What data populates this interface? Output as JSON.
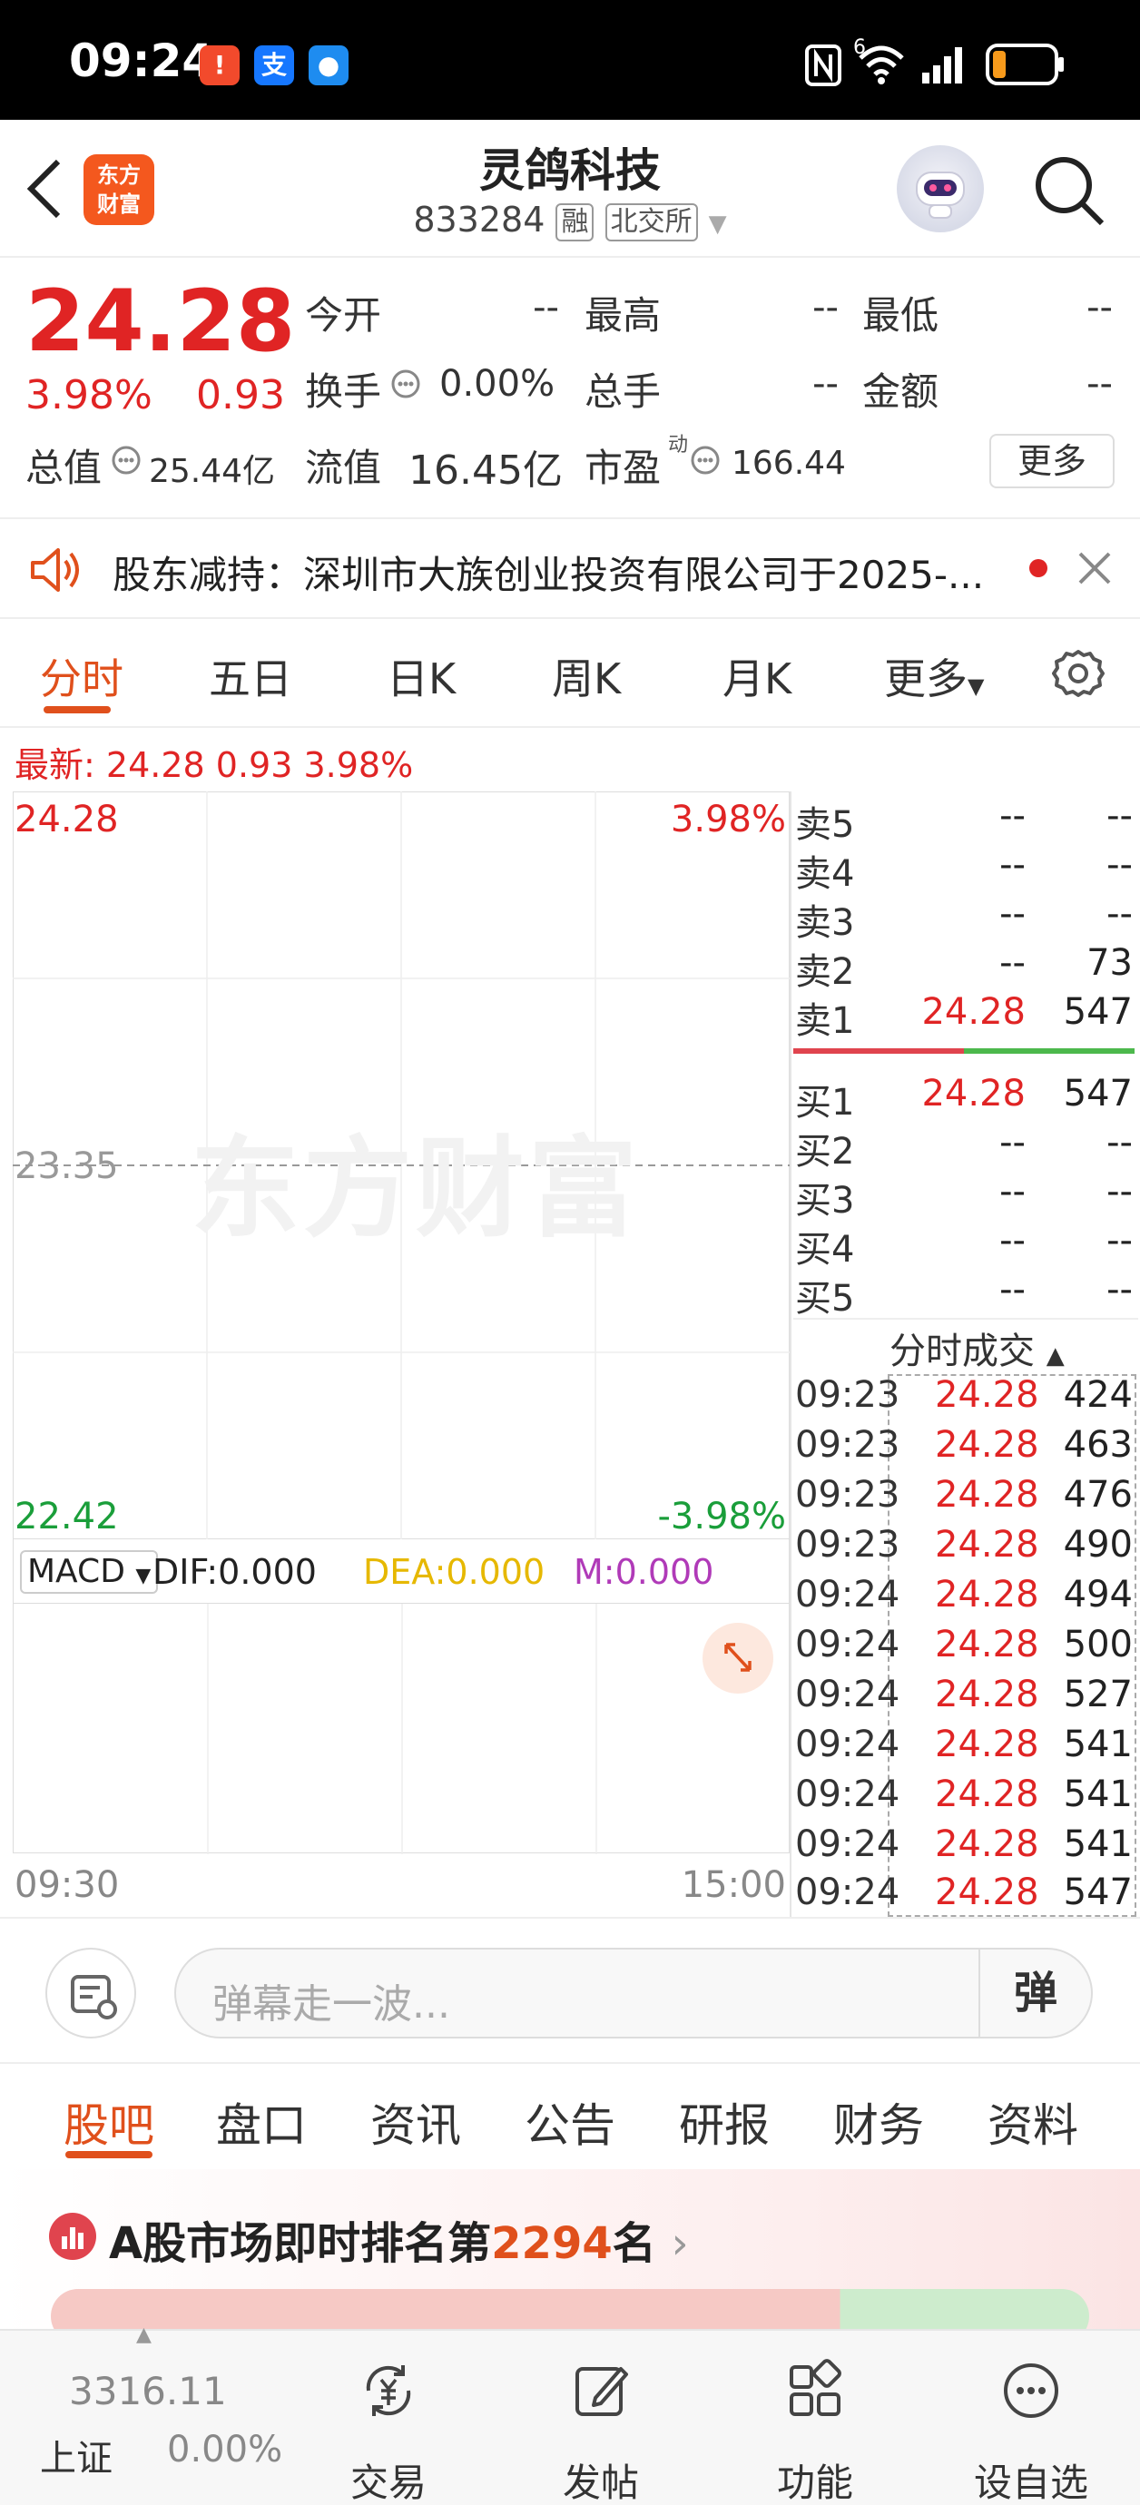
{
  "status_bar": {
    "time": "09:24",
    "network": "6",
    "apps": [
      "notification-app",
      "alipay-app",
      "message-app"
    ],
    "battery_color": "#f79a1b"
  },
  "header": {
    "logo_line1": "东方",
    "logo_line2": "财富",
    "title": "灵鸽科技",
    "code": "833284",
    "tag_margin": "融",
    "tag_exchange": "北交所"
  },
  "quote": {
    "price": "24.28",
    "change_pct": "3.98%",
    "change_amt": "0.93",
    "open_label": "今开",
    "open_value": "--",
    "high_label": "最高",
    "high_value": "--",
    "low_label": "最低",
    "low_value": "--",
    "turnover_label": "换手",
    "turnover_value": "0.00%",
    "volume_label": "总手",
    "volume_value": "--",
    "amount_label": "金额",
    "amount_value": "--",
    "mktcap_label": "总值",
    "mktcap_value": "25.44亿",
    "float_label": "流值",
    "float_value": "16.45亿",
    "pe_label": "市盈",
    "pe_sup": "动",
    "pe_value": "166.44",
    "more_label": "更多"
  },
  "notice": {
    "text": "股东减持：深圳市大族创业投资有限公司于2025-..."
  },
  "chart_tabs": {
    "items": [
      {
        "label": "分时",
        "active": true
      },
      {
        "label": "五日"
      },
      {
        "label": "日K"
      },
      {
        "label": "周K"
      },
      {
        "label": "月K"
      },
      {
        "label": "更多"
      }
    ]
  },
  "latest": {
    "label": "最新:",
    "price": "24.28",
    "change": "0.93",
    "pct": "3.98%"
  },
  "watermark": "东方财富",
  "chart_data": {
    "type": "line",
    "y_top": "24.28",
    "y_mid": "23.35",
    "y_bottom": "22.42",
    "pct_top": "3.98%",
    "pct_bottom": "-3.98%",
    "x_start": "09:30",
    "x_end": "15:00",
    "x": [],
    "series": [],
    "ylim": [
      22.42,
      24.28
    ],
    "grid": true
  },
  "macd": {
    "selector": "MACD",
    "dif": "DIF:0.000",
    "dea": "DEA:0.000",
    "m": "M:0.000",
    "dea_color": "#e6b800",
    "m_color": "#b03ab8"
  },
  "order_book": {
    "asks": [
      {
        "label": "卖5",
        "price": "--",
        "vol": "--"
      },
      {
        "label": "卖4",
        "price": "--",
        "vol": "--"
      },
      {
        "label": "卖3",
        "price": "--",
        "vol": "--"
      },
      {
        "label": "卖2",
        "price": "--",
        "vol": "73"
      },
      {
        "label": "卖1",
        "price": "24.28",
        "vol": "547"
      }
    ],
    "bids": [
      {
        "label": "买1",
        "price": "24.28",
        "vol": "547"
      },
      {
        "label": "买2",
        "price": "--",
        "vol": "--"
      },
      {
        "label": "买3",
        "price": "--",
        "vol": "--"
      },
      {
        "label": "买4",
        "price": "--",
        "vol": "--"
      },
      {
        "label": "买5",
        "price": "--",
        "vol": "--"
      }
    ]
  },
  "time_sales": {
    "title": "分时成交",
    "rows": [
      {
        "time": "09:23",
        "price": "24.28",
        "vol": "424"
      },
      {
        "time": "09:23",
        "price": "24.28",
        "vol": "463"
      },
      {
        "time": "09:23",
        "price": "24.28",
        "vol": "476"
      },
      {
        "time": "09:23",
        "price": "24.28",
        "vol": "490"
      },
      {
        "time": "09:24",
        "price": "24.28",
        "vol": "494"
      },
      {
        "time": "09:24",
        "price": "24.28",
        "vol": "500"
      },
      {
        "time": "09:24",
        "price": "24.28",
        "vol": "527"
      },
      {
        "time": "09:24",
        "price": "24.28",
        "vol": "541"
      },
      {
        "time": "09:24",
        "price": "24.28",
        "vol": "541"
      },
      {
        "time": "09:24",
        "price": "24.28",
        "vol": "541"
      },
      {
        "time": "09:24",
        "price": "24.28",
        "vol": "547"
      }
    ]
  },
  "comment": {
    "placeholder": "弹幕走一波...",
    "send_label": "弹"
  },
  "bottom_tabs": {
    "items": [
      {
        "label": "股吧",
        "active": true
      },
      {
        "label": "盘口"
      },
      {
        "label": "资讯"
      },
      {
        "label": "公告"
      },
      {
        "label": "研报"
      },
      {
        "label": "财务"
      },
      {
        "label": "资料"
      }
    ]
  },
  "rank": {
    "prefix": "A股市场即时排名第",
    "number": "2294",
    "suffix": "名"
  },
  "bottom_nav": {
    "index_value": "3316.11",
    "index_name": "上证",
    "index_change": "0.00%",
    "items": [
      {
        "label": "交易"
      },
      {
        "label": "发帖"
      },
      {
        "label": "功能"
      },
      {
        "label": "设自选"
      }
    ]
  },
  "colors": {
    "up": "#e02424",
    "down": "#1a9e3a",
    "accent": "#e0501c"
  }
}
